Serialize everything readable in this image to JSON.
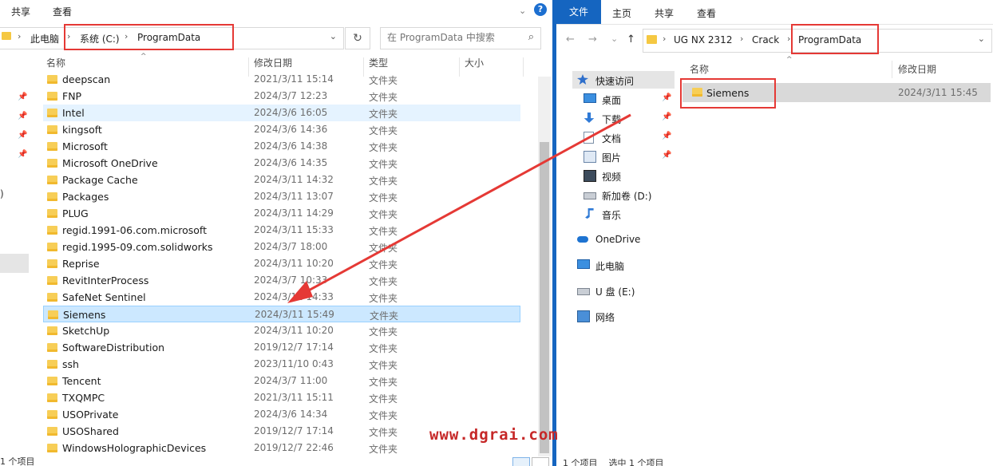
{
  "left": {
    "ribbon": {
      "tabs": [
        "共享",
        "查看"
      ],
      "collapse": "⌄",
      "help": "?"
    },
    "address": {
      "segments": [
        "此电脑",
        "系统 (C:)",
        "ProgramData"
      ],
      "dropdown": "⌄"
    },
    "refresh": "↻",
    "search": {
      "placeholder": "在 ProgramData 中搜索",
      "icon": "⌕"
    },
    "columns": {
      "name": "名称",
      "date": "修改日期",
      "type": "类型",
      "size": "大小"
    },
    "nav_paren": ")",
    "files": [
      {
        "name": "deepscan",
        "date": "2021/3/11 15:14",
        "type": "文件夹"
      },
      {
        "name": "FNP",
        "date": "2024/3/7 12:23",
        "type": "文件夹"
      },
      {
        "name": "Intel",
        "date": "2024/3/6 16:05",
        "type": "文件夹"
      },
      {
        "name": "kingsoft",
        "date": "2024/3/6 14:36",
        "type": "文件夹"
      },
      {
        "name": "Microsoft",
        "date": "2024/3/6 14:38",
        "type": "文件夹"
      },
      {
        "name": "Microsoft OneDrive",
        "date": "2024/3/6 14:35",
        "type": "文件夹"
      },
      {
        "name": "Package Cache",
        "date": "2024/3/11 14:32",
        "type": "文件夹"
      },
      {
        "name": "Packages",
        "date": "2024/3/11 13:07",
        "type": "文件夹"
      },
      {
        "name": "PLUG",
        "date": "2024/3/11 14:29",
        "type": "文件夹"
      },
      {
        "name": "regid.1991-06.com.microsoft",
        "date": "2024/3/11 15:33",
        "type": "文件夹"
      },
      {
        "name": "regid.1995-09.com.solidworks",
        "date": "2024/3/7 18:00",
        "type": "文件夹"
      },
      {
        "name": "Reprise",
        "date": "2024/3/11 10:20",
        "type": "文件夹"
      },
      {
        "name": "RevitInterProcess",
        "date": "2024/3/7 10:33",
        "type": "文件夹"
      },
      {
        "name": "SafeNet Sentinel",
        "date": "2024/3/11 14:33",
        "type": "文件夹"
      },
      {
        "name": "Siemens",
        "date": "2024/3/11 15:49",
        "type": "文件夹"
      },
      {
        "name": "SketchUp",
        "date": "2024/3/11 10:20",
        "type": "文件夹"
      },
      {
        "name": "SoftwareDistribution",
        "date": "2019/12/7 17:14",
        "type": "文件夹"
      },
      {
        "name": "ssh",
        "date": "2023/11/10 0:43",
        "type": "文件夹"
      },
      {
        "name": "Tencent",
        "date": "2024/3/7 11:00",
        "type": "文件夹"
      },
      {
        "name": "TXQMPC",
        "date": "2021/3/11 15:11",
        "type": "文件夹"
      },
      {
        "name": "USOPrivate",
        "date": "2024/3/6 14:34",
        "type": "文件夹"
      },
      {
        "name": "USOShared",
        "date": "2019/12/7 17:14",
        "type": "文件夹"
      },
      {
        "name": "WindowsHolographicDevices",
        "date": "2019/12/7 22:46",
        "type": "文件夹"
      }
    ],
    "status": "1 个项目"
  },
  "right": {
    "ribbon": {
      "tabs": [
        "文件",
        "主页",
        "共享",
        "查看"
      ]
    },
    "nav_buttons": {
      "back": "←",
      "forward": "→",
      "recent": "⌄",
      "up": "↑"
    },
    "address": {
      "segments": [
        "UG NX 2312",
        "Crack",
        "ProgramData"
      ],
      "dropdown": "⌄"
    },
    "columns": {
      "name": "名称",
      "date": "修改日期"
    },
    "nav": [
      {
        "label": "快速访问",
        "icon": "star-icon"
      },
      {
        "label": "桌面",
        "icon": "desktop-icon"
      },
      {
        "label": "下载",
        "icon": "download-icon"
      },
      {
        "label": "文档",
        "icon": "document-icon"
      },
      {
        "label": "图片",
        "icon": "picture-icon"
      },
      {
        "label": "视频",
        "icon": "video-icon"
      },
      {
        "label": "新加卷 (D:)",
        "icon": "drive-icon"
      },
      {
        "label": "音乐",
        "icon": "music-icon"
      },
      {
        "label": "OneDrive",
        "icon": "cloud-icon"
      },
      {
        "label": "此电脑",
        "icon": "computer-icon"
      },
      {
        "label": "U 盘 (E:)",
        "icon": "usb-drive-icon"
      },
      {
        "label": "网络",
        "icon": "network-icon"
      }
    ],
    "files": [
      {
        "name": "Siemens",
        "date": "2024/3/11 15:45"
      }
    ],
    "status": "1 个项目    选中 1 个项目"
  },
  "watermark": "www.dgrai.com",
  "colors": {
    "accent": "#1565c0",
    "annotation": "#e53935",
    "selection": "#cce8ff",
    "folder": "#f7ce57"
  }
}
